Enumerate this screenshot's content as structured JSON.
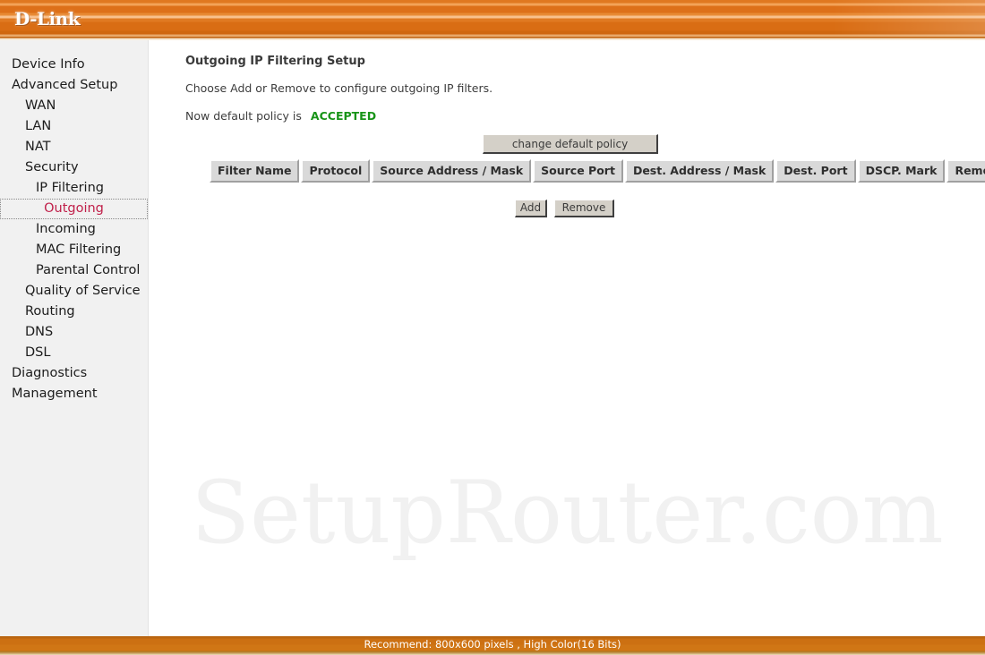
{
  "brand": {
    "logo_text": "D-Link"
  },
  "sidebar": {
    "items": [
      {
        "label": "Device Info",
        "level": 0,
        "selected": false
      },
      {
        "label": "Advanced Setup",
        "level": 0,
        "selected": false
      },
      {
        "label": "WAN",
        "level": 1,
        "selected": false
      },
      {
        "label": "LAN",
        "level": 1,
        "selected": false
      },
      {
        "label": "NAT",
        "level": 1,
        "selected": false
      },
      {
        "label": "Security",
        "level": 1,
        "selected": false
      },
      {
        "label": "IP Filtering",
        "level": 2,
        "selected": false
      },
      {
        "label": "Outgoing",
        "level": 2,
        "selected": true
      },
      {
        "label": "Incoming",
        "level": 2,
        "selected": false
      },
      {
        "label": "MAC Filtering",
        "level": 2,
        "selected": false
      },
      {
        "label": "Parental Control",
        "level": 2,
        "selected": false
      },
      {
        "label": "Quality of Service",
        "level": 1,
        "selected": false
      },
      {
        "label": "Routing",
        "level": 1,
        "selected": false
      },
      {
        "label": "DNS",
        "level": 1,
        "selected": false
      },
      {
        "label": "DSL",
        "level": 1,
        "selected": false
      },
      {
        "label": "Diagnostics",
        "level": 0,
        "selected": false
      },
      {
        "label": "Management",
        "level": 0,
        "selected": false
      }
    ]
  },
  "main": {
    "title": "Outgoing IP Filtering Setup",
    "instructions": "Choose Add or Remove to configure outgoing IP filters.",
    "policy_label": "Now default policy is",
    "policy_value": "ACCEPTED",
    "policy_value_color": "#189418",
    "change_policy_label": "change default policy",
    "table": {
      "columns": [
        "Filter Name",
        "Protocol",
        "Source Address / Mask",
        "Source Port",
        "Dest. Address / Mask",
        "Dest. Port",
        "DSCP. Mark",
        "Remove"
      ],
      "rows": []
    },
    "add_label": "Add",
    "remove_label": "Remove"
  },
  "watermark": {
    "text": "SetupRouter.com"
  },
  "footer": {
    "text": "Recommend: 800x600 pixels , High Color(16 Bits)"
  }
}
